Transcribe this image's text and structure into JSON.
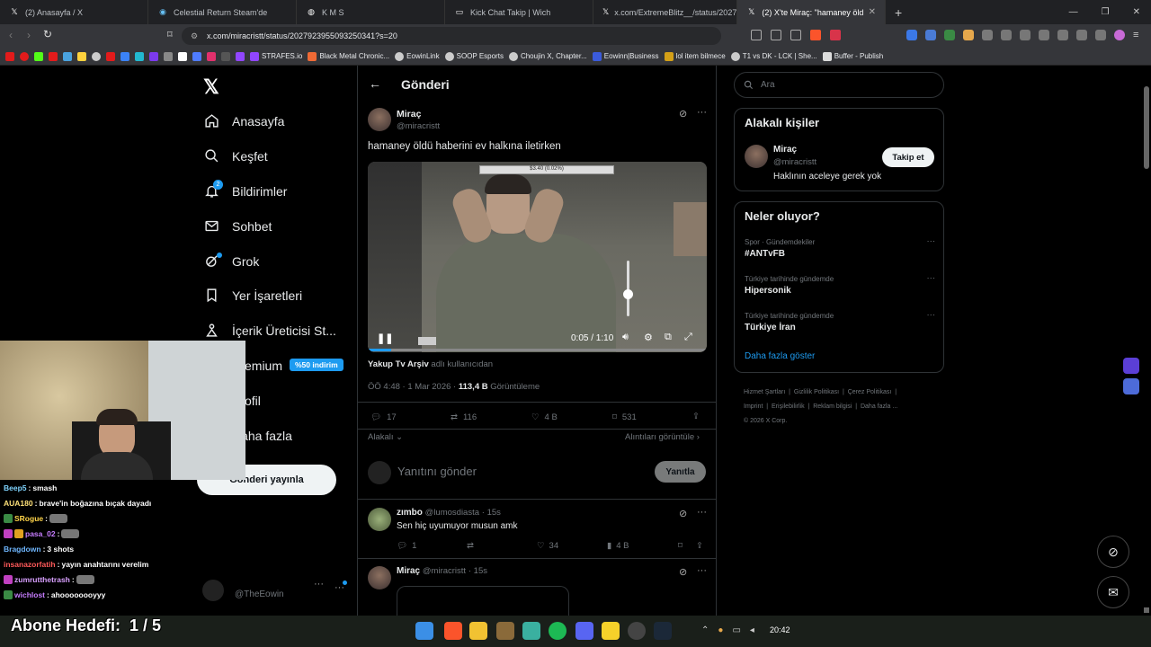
{
  "tabs": [
    {
      "label": "(2) Anasayfa / X",
      "icon": "x-icon"
    },
    {
      "label": "Celestial Return Steam'de",
      "icon": "steam-icon"
    },
    {
      "label": "K M S",
      "icon": "globe-icon"
    },
    {
      "label": "Kick Chat Takip | Wich",
      "icon": "page-icon"
    },
    {
      "label": "x.com/ExtremeBlitz__/status/202785",
      "icon": "x-icon"
    },
    {
      "label": "(2) X'te Miraç: \"hamaney öldü",
      "icon": "x-icon",
      "active": true
    }
  ],
  "address": {
    "url": "x.com/miracristt/status/2027923955093250341?s=20"
  },
  "bookmarks": [
    "STRAFES.io",
    "Black Metal Chronic...",
    "EowinLink",
    "SOOP Esports",
    "Choujin X, Chapter...",
    "Eowinn|Business",
    "lol item bilmece",
    "T1 vs DK - LCK | She...",
    "Buffer - Publish"
  ],
  "nav": {
    "home": "Anasayfa",
    "explore": "Keşfet",
    "notifications": "Bildirimler",
    "notif_badge": "2",
    "messages": "Sohbet",
    "grok": "Grok",
    "bookmarks": "Yer İşaretleri",
    "creator": "İçerik Üreticisi St...",
    "premium": "Premium",
    "premium_badge": "%50 indirim",
    "profile": "Profil",
    "more": "Daha fazla",
    "post_button": "Gönderi yayınla",
    "account_handle": "@TheEowin"
  },
  "header": {
    "title": "Gönderi"
  },
  "post": {
    "name": "Miraç",
    "handle": "@miracristt",
    "text": "hamaney öldü haberini ev halkına iletirken",
    "video_time": "0:05 / 1:10",
    "source_name": "Yakup Tv Arşiv",
    "source_suffix": "adlı kullanıcıdan",
    "timestamp": "ÖÖ 4:48 · 1 Mar 2026 · ",
    "views": "113,4 B",
    "views_label": "Görüntüleme",
    "replies": "17",
    "reposts": "116",
    "likes": "4 B",
    "bookmarks": "531",
    "relevance": "Alakalı",
    "quotes": "Alıntıları görüntüle",
    "reply_placeholder": "Yanıtını gönder",
    "reply_button": "Yanıtla",
    "overlay_top": "$3.40 (0.02%)",
    "overlay_bottom": "0 (0.00%)"
  },
  "replies": [
    {
      "name": "zımbo",
      "handle": "@lumosdiasta",
      "time": "· 15s",
      "text": "Sen hiç uyumuyor musun amk",
      "replies": "1",
      "reposts": "",
      "likes": "34",
      "views": "4 B"
    },
    {
      "name": "Miraç",
      "handle": "@miracristt",
      "time": "· 15s",
      "text": ""
    }
  ],
  "search": {
    "placeholder": "Ara"
  },
  "relevant": {
    "title": "Alakalı kişiler",
    "name": "Miraç",
    "handle": "@miracristt",
    "bio": "Haklının aceleye gerek yok",
    "follow": "Takip et"
  },
  "trends": {
    "title": "Neler oluyor?",
    "items": [
      {
        "context": "Spor · Gündemdekiler",
        "name": "#ANTvFB"
      },
      {
        "context": "Türkiye tarihinde gündemde",
        "name": "Hipersonik"
      },
      {
        "context": "Türkiye tarihinde gündemde",
        "name": "Türkiye İran"
      }
    ],
    "more": "Daha fazla göster"
  },
  "footer": [
    "Hizmet Şartları",
    "Gizlilik Politikası",
    "Çerez Politikası",
    "Imprint",
    "Erişilebilirlik",
    "Reklam bilgisi",
    "Daha fazla ...",
    "© 2026 X Corp."
  ],
  "chat": [
    {
      "user": "Beep5",
      "msg": "smash",
      "color": "#7fd4ff"
    },
    {
      "user": "AUA180",
      "msg": "brave'in boğazına bıçak dayadı",
      "color": "#ffe27a"
    },
    {
      "user": "SRogue",
      "msg": "",
      "color": "#ffd54a"
    },
    {
      "user": "pasa_02",
      "msg": "",
      "color": "#c77dff"
    },
    {
      "user": "Bragdown",
      "msg": "3 shots",
      "color": "#6fb7ff"
    },
    {
      "user": "insanazorfatih",
      "msg": "yayın anahtarını verelim",
      "color": "#ff5a5a"
    },
    {
      "user": "zumrutthetrash",
      "msg": "",
      "color": "#d9a0ff"
    },
    {
      "user": "wichlost",
      "msg": "ahoooooooyyy",
      "color": "#c77dff"
    }
  ],
  "goal": {
    "label": "Abone Hedefi:",
    "value": "1 / 5"
  },
  "clock": "20:42",
  "colors": {
    "accent": "#1d9bf0",
    "bg": "#000000",
    "border": "#2f3336",
    "muted": "#71767b"
  }
}
